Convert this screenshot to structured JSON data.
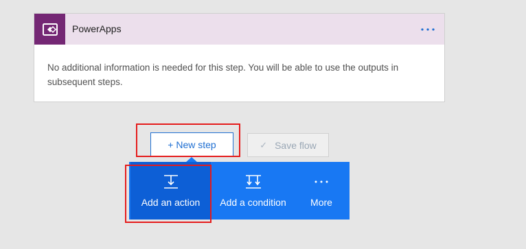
{
  "card": {
    "title": "PowerApps",
    "logo_icon": "powerapps-logo-icon",
    "more_icon": "ellipsis-icon",
    "body_text": "No additional information is needed for this step. You will be able to use the outputs in subsequent steps."
  },
  "actions": {
    "new_step_label": "+ New step",
    "save_flow_label": "Save flow",
    "save_flow_icon": "checkmark-icon"
  },
  "menu": {
    "items": [
      {
        "label": "Add an action",
        "icon": "add-action-icon"
      },
      {
        "label": "Add a condition",
        "icon": "add-condition-icon"
      },
      {
        "label": "More",
        "icon": "ellipsis-icon"
      }
    ]
  },
  "colors": {
    "brand_purple": "#742774",
    "header_tint": "#ecdfec",
    "menu_blue": "#1878f3",
    "menu_selected": "#0d5fd6",
    "highlight_red": "#e51b1b",
    "link_blue": "#1f6fd2"
  }
}
